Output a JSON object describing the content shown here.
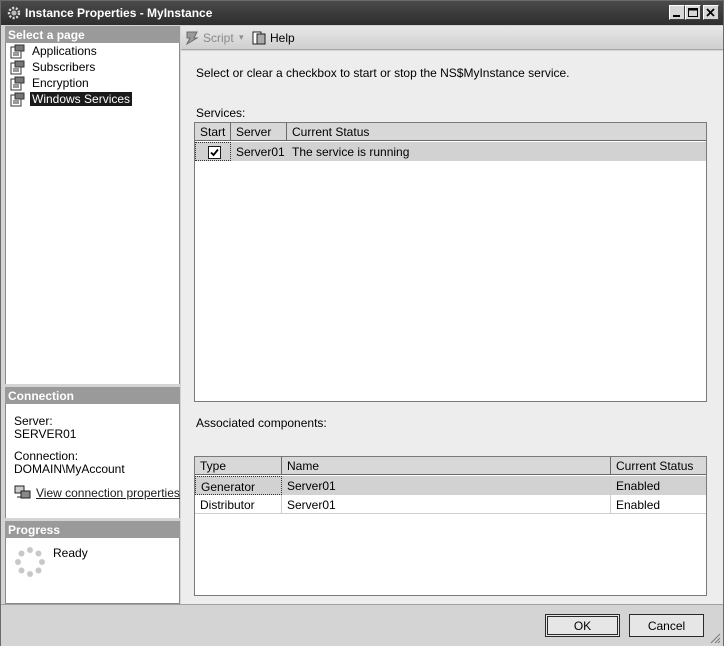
{
  "window": {
    "title": "Instance Properties - MyInstance"
  },
  "left": {
    "select_page_header": "Select a page",
    "pages": [
      {
        "label": "Applications",
        "selected": false
      },
      {
        "label": "Subscribers",
        "selected": false
      },
      {
        "label": "Encryption",
        "selected": false
      },
      {
        "label": "Windows Services",
        "selected": true
      }
    ],
    "connection_header": "Connection",
    "server_label": "Server:",
    "server_value": "SERVER01",
    "connection_label": "Connection:",
    "connection_value": "DOMAIN\\MyAccount",
    "view_connection_link": "View connection properties",
    "progress_header": "Progress",
    "progress_status": "Ready"
  },
  "toolbar": {
    "script_label": "Script",
    "help_label": "Help"
  },
  "main": {
    "instruction": "Select or clear a checkbox to start or stop the NS$MyInstance service.",
    "services_label": "Services:",
    "services_columns": [
      "Start",
      "Server",
      "Current Status"
    ],
    "services_rows": [
      {
        "checked": true,
        "server": "Server01",
        "status": "The service is running"
      }
    ],
    "components_label": "Associated components:",
    "components_columns": [
      "Type",
      "Name",
      "Current Status"
    ],
    "components_rows": [
      {
        "type": "Generator",
        "name": "Server01",
        "status": "Enabled"
      },
      {
        "type": "Distributor",
        "name": "Server01",
        "status": "Enabled"
      }
    ]
  },
  "buttons": {
    "ok": "OK",
    "cancel": "Cancel"
  },
  "colors": {
    "titlebar": "#3a3a3a",
    "selection": "#1a1a1a",
    "panel_header": "#9a9a9a"
  }
}
